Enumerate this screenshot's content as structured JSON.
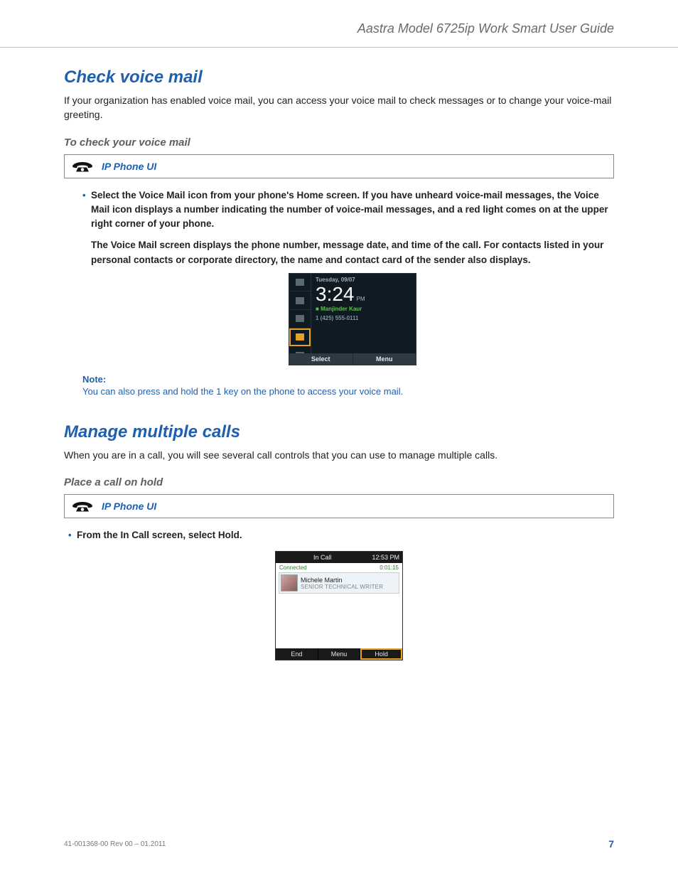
{
  "header": {
    "guide_title": "Aastra Model 6725ip Work Smart User Guide"
  },
  "section1": {
    "heading": "Check voice mail",
    "intro": "If your organization has enabled voice mail, you can access your voice mail to check messages or to change your voice-mail greeting.",
    "sub": "To check your voice mail",
    "ui_label": "IP Phone UI",
    "bullet_prefix": "Select the ",
    "bullet_bold1": "Voice Mail",
    "bullet_mid1": " icon from your phone's ",
    "bullet_bold2": "Home",
    "bullet_suffix": " screen. If you have unheard voice-mail messages, the Voice Mail icon displays a number indicating the number of voice-mail messages, and a red light comes on at the upper right corner of your phone.",
    "bullet_para2": "The Voice Mail screen displays the phone number, message date, and time of the call. For contacts listed in your personal contacts or corporate directory, the name and contact card of the sender also displays.",
    "note_label": "Note:",
    "note_text": "You can also press and hold the 1 key on the phone to access your voice mail."
  },
  "shot1": {
    "date": "Tuesday, 09/07",
    "time": "3:24",
    "pm": "PM",
    "name": "Manjinder Kaur",
    "number": "1 (425) 555-0111",
    "softkey_left": "Select",
    "softkey_right": "Menu"
  },
  "section2": {
    "heading": "Manage multiple calls",
    "intro": "When you are in a call, you will see several call controls that you can use to manage multiple calls.",
    "sub": "Place a call on hold",
    "ui_label": "IP Phone UI",
    "bullet_prefix": "From the ",
    "bullet_bold1": "In Call",
    "bullet_mid1": " screen, select ",
    "bullet_bold2": "Hold",
    "bullet_suffix": "."
  },
  "shot2": {
    "title": "In Call",
    "clock": "12:53 PM",
    "status": "Connected",
    "timer": "0:01:15",
    "name": "Michele Martin",
    "role": "SENIOR TECHNICAL WRITER",
    "sk1": "End",
    "sk2": "Menu",
    "sk3": "Hold"
  },
  "footer": {
    "rev": "41-001368-00 Rev 00  – 01.2011",
    "page": "7"
  }
}
